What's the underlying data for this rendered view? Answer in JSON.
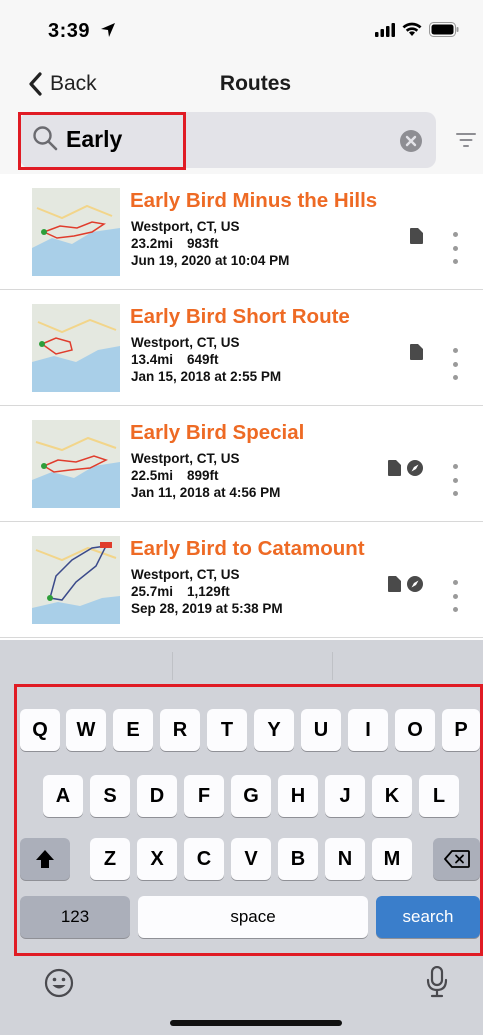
{
  "status_bar": {
    "time": "3:39"
  },
  "nav": {
    "back_label": "Back",
    "title": "Routes"
  },
  "search": {
    "value": "Early",
    "highlight_color": "#e01b24"
  },
  "accent_color": "#ee6a24",
  "routes": [
    {
      "name": "Early Bird Minus the Hills",
      "location": "Westport, CT, US",
      "distance": "23.2mi",
      "elevation": "983ft",
      "date": "Jun 19, 2020 at 10:04 PM",
      "icons": [
        "document-icon"
      ]
    },
    {
      "name": "Early Bird Short Route",
      "location": "Westport, CT, US",
      "distance": "13.4mi",
      "elevation": "649ft",
      "date": "Jan 15, 2018 at 2:55 PM",
      "icons": [
        "document-icon"
      ]
    },
    {
      "name": "Early Bird Special",
      "location": "Westport, CT, US",
      "distance": "22.5mi",
      "elevation": "899ft",
      "date": "Jan 11, 2018 at 4:56 PM",
      "icons": [
        "document-icon",
        "compass-icon"
      ]
    },
    {
      "name": "Early Bird to Catamount",
      "location": "Westport, CT, US",
      "distance": "25.7mi",
      "elevation": "1,129ft",
      "date": "Sep 28, 2019 at 5:38 PM",
      "icons": [
        "document-icon",
        "compass-icon"
      ]
    }
  ],
  "keyboard": {
    "row1": [
      "Q",
      "W",
      "E",
      "R",
      "T",
      "Y",
      "U",
      "I",
      "O",
      "P"
    ],
    "row2": [
      "A",
      "S",
      "D",
      "F",
      "G",
      "H",
      "J",
      "K",
      "L"
    ],
    "row3": [
      "Z",
      "X",
      "C",
      "V",
      "B",
      "N",
      "M"
    ],
    "numbers_label": "123",
    "space_label": "space",
    "search_label": "search"
  }
}
